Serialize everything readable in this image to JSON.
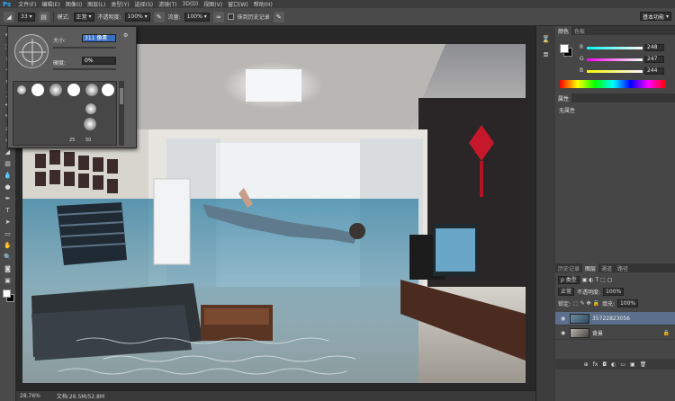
{
  "app": {
    "logo": "Ps"
  },
  "menu": [
    "文件(F)",
    "编辑(E)",
    "图像(I)",
    "图层(L)",
    "类型(Y)",
    "选择(S)",
    "滤镜(T)",
    "3D(D)",
    "视图(V)",
    "窗口(W)",
    "帮助(H)"
  ],
  "options": {
    "brush_size_value": "33",
    "mode_label": "模式:",
    "mode_value": "正常",
    "opacity_label": "不透明度:",
    "opacity_value": "100%",
    "flow_label": "流量:",
    "flow_value": "100%",
    "history_label": "抹到历史记录",
    "workspace_value": "基本功能"
  },
  "brush_picker": {
    "size_label": "大小:",
    "size_value": "311 像素",
    "hardness_label": "硬度:",
    "hardness_value": "0%",
    "tip_numbers": [
      "25",
      "50"
    ]
  },
  "status": {
    "zoom": "28.76%",
    "doc": "文档:26.5M/52.8M"
  },
  "color_panel": {
    "tabs": [
      "颜色",
      "色板"
    ],
    "rows": [
      {
        "label": "R",
        "value": "248",
        "gradient": "linear-gradient(to right, #00f7f4, #fff7f4)"
      },
      {
        "label": "G",
        "value": "247",
        "gradient": "linear-gradient(to right, #f800f4, #f8fff4)"
      },
      {
        "label": "B",
        "value": "244",
        "gradient": "linear-gradient(to right, #f8f700, #f8f7ff)"
      }
    ]
  },
  "properties_panel": {
    "tab": "属性",
    "body": "无属性"
  },
  "layers_panel": {
    "tabs": [
      "历史记录",
      "图层",
      "通道",
      "路径"
    ],
    "kind_label": "ρ 类型",
    "blend_mode": "正常",
    "opacity_label": "不透明度:",
    "opacity_value": "100%",
    "lock_label": "锁定:",
    "fill_label": "填充:",
    "fill_value": "100%",
    "layers": [
      {
        "name": "35722823056",
        "selected": true
      },
      {
        "name": "背景",
        "selected": false,
        "locked": true
      }
    ]
  }
}
